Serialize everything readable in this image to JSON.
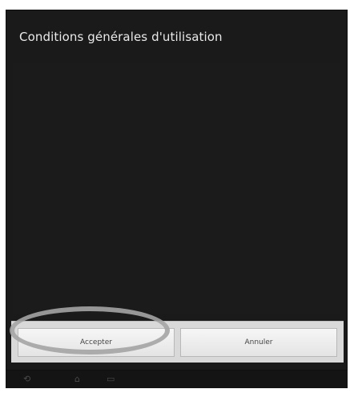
{
  "dialog": {
    "title": "Conditions générales d'utilisation",
    "accept_label": "Accepter",
    "cancel_label": "Annuler"
  },
  "nav": {
    "back_glyph": "⟲",
    "home_glyph": "⌂",
    "recent_glyph": "▭"
  },
  "colors": {
    "dialog_background": "#1b1a1a",
    "title_text": "#e9e9e9",
    "button_bar": "#d9d9d9",
    "highlight": "#a4a4a4"
  },
  "icons": [
    "back-icon",
    "home-icon",
    "recent-apps-icon"
  ]
}
